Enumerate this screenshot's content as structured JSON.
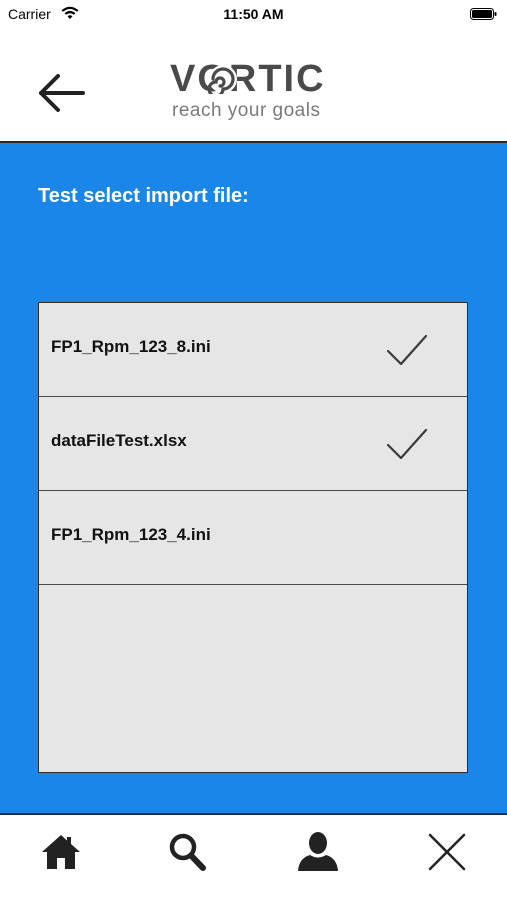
{
  "status_bar": {
    "carrier": "Carrier",
    "time": "11:50 AM"
  },
  "header": {
    "back_icon": "arrow-left-icon",
    "logo": {
      "text": "VORTIC",
      "tagline": "reach your goals"
    }
  },
  "main": {
    "title": "Test select import file:",
    "files": [
      {
        "name": "FP1_Rpm_123_8.ini",
        "selected": true
      },
      {
        "name": "dataFileTest.xlsx",
        "selected": true
      },
      {
        "name": "FP1_Rpm_123_4.ini",
        "selected": false
      }
    ]
  },
  "tab_bar": {
    "items": [
      {
        "icon": "home-icon"
      },
      {
        "icon": "search-icon"
      },
      {
        "icon": "user-icon"
      },
      {
        "icon": "close-icon"
      }
    ]
  },
  "colors": {
    "accent": "#1a86e8",
    "list_bg": "#e6e6e6",
    "dark": "#2b2b2b"
  }
}
